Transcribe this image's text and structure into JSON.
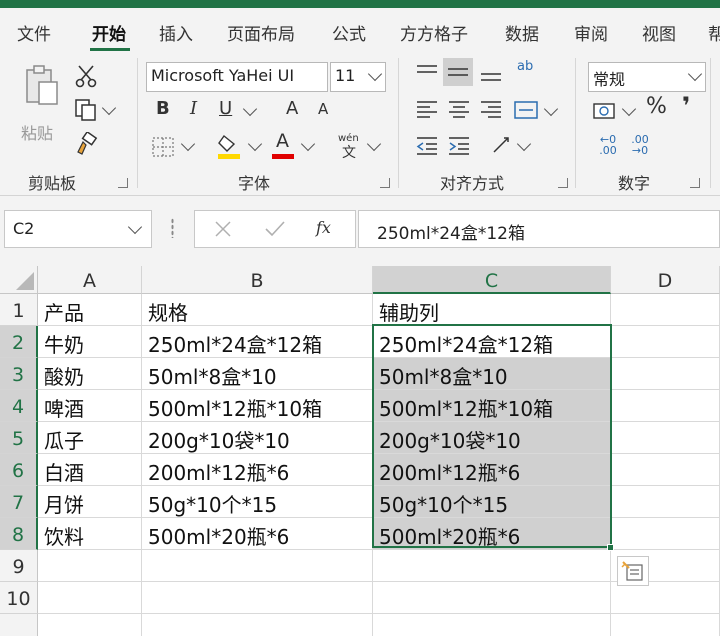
{
  "ribbon_tabs": [
    "文件",
    "开始",
    "插入",
    "页面布局",
    "公式",
    "方方格子",
    "数据",
    "审阅",
    "视图",
    "帮"
  ],
  "active_tab": "开始",
  "clipboard": {
    "paste_label": "粘贴",
    "group_label": "剪贴板"
  },
  "font": {
    "name": "Microsoft YaHei UI",
    "size": "11",
    "bold": "B",
    "italic": "I",
    "underline": "U",
    "grow": "A",
    "shrink": "A",
    "phonetic_top": "wén",
    "phonetic_bottom": "文",
    "color_glyph": "A",
    "group_label": "字体"
  },
  "alignment": {
    "group_label": "对齐方式",
    "wrap_glyph": "ab"
  },
  "number": {
    "format": "常规",
    "percent": "%",
    "comma": "❜",
    "inc_decimal": "←0 .00",
    "dec_decimal": ".00 →0",
    "group_label": "数字"
  },
  "formula_bar": {
    "name_box": "C2",
    "fx": "fx",
    "formula": "250ml*24盒*12箱"
  },
  "columns": [
    "A",
    "B",
    "C",
    "D"
  ],
  "rows": [
    "1",
    "2",
    "3",
    "4",
    "5",
    "6",
    "7",
    "8",
    "9",
    "10"
  ],
  "sheet": [
    [
      "产品",
      "规格",
      "辅助列"
    ],
    [
      "牛奶",
      "250ml*24盒*12箱",
      "250ml*24盒*12箱"
    ],
    [
      "酸奶",
      "50ml*8盒*10",
      "50ml*8盒*10"
    ],
    [
      "啤酒",
      "500ml*12瓶*10箱",
      "500ml*12瓶*10箱"
    ],
    [
      "瓜子",
      "200g*10袋*10",
      "200g*10袋*10"
    ],
    [
      "白酒",
      "200ml*12瓶*6",
      "200ml*12瓶*6"
    ],
    [
      "月饼",
      "50g*10个*15",
      "50g*10个*15"
    ],
    [
      "饮料",
      "500ml*20瓶*6",
      "500ml*20瓶*6"
    ]
  ],
  "colors": {
    "accent": "#217346",
    "selection_fill": "#d0d0d0",
    "font_color_bar": "#e00000",
    "highlight_bar": "#ffd800"
  }
}
